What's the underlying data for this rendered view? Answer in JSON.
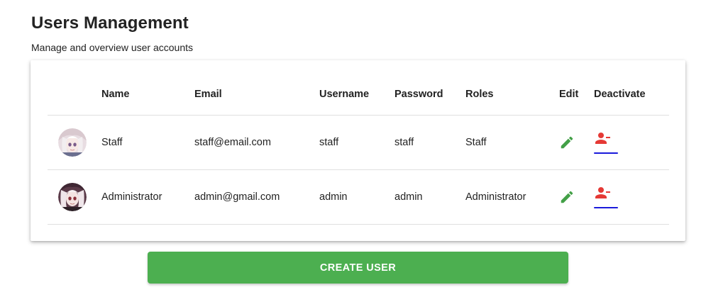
{
  "header": {
    "title": "Users Management",
    "subtitle": "Manage and overview user accounts"
  },
  "table": {
    "columns": {
      "name": "Name",
      "email": "Email",
      "username": "Username",
      "password": "Password",
      "roles": "Roles",
      "edit": "Edit",
      "deactivate": "Deactivate"
    },
    "rows": [
      {
        "name": "Staff",
        "email": "staff@email.com",
        "username": "staff",
        "password": "staff",
        "roles": "Staff"
      },
      {
        "name": "Administrator",
        "email": "admin@gmail.com",
        "username": "admin",
        "password": "admin",
        "roles": "Administrator"
      }
    ]
  },
  "actions": {
    "create_label": "CREATE USER"
  },
  "icons": {
    "edit": "pencil-icon",
    "deactivate": "person-remove-icon"
  },
  "colors": {
    "primary": "#4caf50",
    "edit_icon": "#43a047",
    "deactivate_icon": "#e53935",
    "focus_underline": "#1a1adb"
  }
}
